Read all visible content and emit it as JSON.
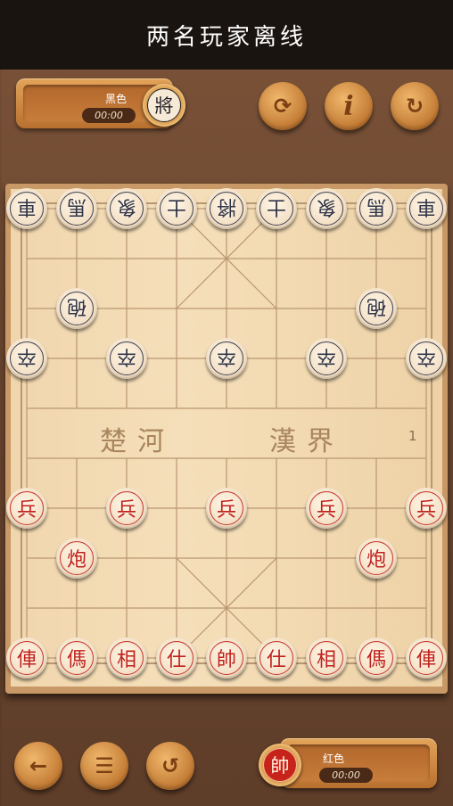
{
  "header": {
    "title": "两名玩家离线"
  },
  "black_player": {
    "name": "黑色",
    "timer": "00:00",
    "general": "將"
  },
  "red_player": {
    "name": "红色",
    "timer": "00:00",
    "general": "帥"
  },
  "toolbar_top": {
    "flip": {
      "icon": "flip-board-icon",
      "glyph": "⟳"
    },
    "info": {
      "icon": "info-icon",
      "glyph": "i"
    },
    "restart": {
      "icon": "restart-icon",
      "glyph": "↻"
    }
  },
  "toolbar_bottom": {
    "back": {
      "icon": "back-arrow-icon",
      "glyph": "←"
    },
    "menu": {
      "icon": "menu-icon",
      "glyph": "☰"
    },
    "undo": {
      "icon": "undo-icon",
      "glyph": "↺"
    }
  },
  "board": {
    "river_left": "楚河",
    "river_right": "漢界",
    "move_number": "1",
    "pieces": [
      {
        "side": "black",
        "char": "車",
        "col": 0,
        "row": 0
      },
      {
        "side": "black",
        "char": "馬",
        "col": 1,
        "row": 0
      },
      {
        "side": "black",
        "char": "象",
        "col": 2,
        "row": 0
      },
      {
        "side": "black",
        "char": "士",
        "col": 3,
        "row": 0
      },
      {
        "side": "black",
        "char": "將",
        "col": 4,
        "row": 0
      },
      {
        "side": "black",
        "char": "士",
        "col": 5,
        "row": 0
      },
      {
        "side": "black",
        "char": "象",
        "col": 6,
        "row": 0
      },
      {
        "side": "black",
        "char": "馬",
        "col": 7,
        "row": 0
      },
      {
        "side": "black",
        "char": "車",
        "col": 8,
        "row": 0
      },
      {
        "side": "black",
        "char": "砲",
        "col": 1,
        "row": 2
      },
      {
        "side": "black",
        "char": "砲",
        "col": 7,
        "row": 2
      },
      {
        "side": "black",
        "char": "卒",
        "col": 0,
        "row": 3
      },
      {
        "side": "black",
        "char": "卒",
        "col": 2,
        "row": 3
      },
      {
        "side": "black",
        "char": "卒",
        "col": 4,
        "row": 3
      },
      {
        "side": "black",
        "char": "卒",
        "col": 6,
        "row": 3
      },
      {
        "side": "black",
        "char": "卒",
        "col": 8,
        "row": 3
      },
      {
        "side": "red",
        "char": "兵",
        "col": 0,
        "row": 6
      },
      {
        "side": "red",
        "char": "兵",
        "col": 2,
        "row": 6
      },
      {
        "side": "red",
        "char": "兵",
        "col": 4,
        "row": 6
      },
      {
        "side": "red",
        "char": "兵",
        "col": 6,
        "row": 6
      },
      {
        "side": "red",
        "char": "兵",
        "col": 8,
        "row": 6
      },
      {
        "side": "red",
        "char": "炮",
        "col": 1,
        "row": 7
      },
      {
        "side": "red",
        "char": "炮",
        "col": 7,
        "row": 7
      },
      {
        "side": "red",
        "char": "俥",
        "col": 0,
        "row": 9
      },
      {
        "side": "red",
        "char": "傌",
        "col": 1,
        "row": 9
      },
      {
        "side": "red",
        "char": "相",
        "col": 2,
        "row": 9
      },
      {
        "side": "red",
        "char": "仕",
        "col": 3,
        "row": 9
      },
      {
        "side": "red",
        "char": "帥",
        "col": 4,
        "row": 9
      },
      {
        "side": "red",
        "char": "仕",
        "col": 5,
        "row": 9
      },
      {
        "side": "red",
        "char": "相",
        "col": 6,
        "row": 9
      },
      {
        "side": "red",
        "char": "傌",
        "col": 7,
        "row": 9
      },
      {
        "side": "red",
        "char": "俥",
        "col": 8,
        "row": 9
      }
    ]
  }
}
